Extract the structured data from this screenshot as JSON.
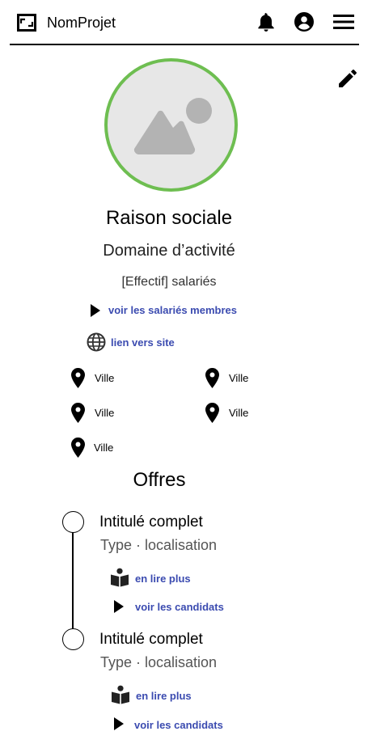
{
  "header": {
    "brand": "NomProjet",
    "icons": [
      "app-logo-icon",
      "bell-icon",
      "account-icon",
      "menu-icon"
    ]
  },
  "edit": {
    "icon": "edit-icon"
  },
  "profile": {
    "avatar_icon": "image-placeholder-icon",
    "avatar_ring_color": "#6ebe51",
    "company_name": "Raison sociale",
    "domain": "Domaine d’activité",
    "staff": "[Effectif] salariés",
    "see_members": "voir les salariés membres",
    "website": "lien vers site"
  },
  "cities": [
    "Ville",
    "Ville",
    "Ville",
    "Ville",
    "Ville"
  ],
  "offers": {
    "title": "Offres",
    "items": [
      {
        "title": "Intitulé complet",
        "subtitle": "Type · localisation",
        "read_more": "en lire plus",
        "see_candidates": "voir les candidats"
      },
      {
        "title": "Intitulé complet",
        "subtitle": "Type · localisation",
        "read_more": "en lire plus",
        "see_candidates": "voir les candidats"
      }
    ]
  },
  "colors": {
    "link": "#3b4bb0",
    "accent": "#6ebe51"
  }
}
